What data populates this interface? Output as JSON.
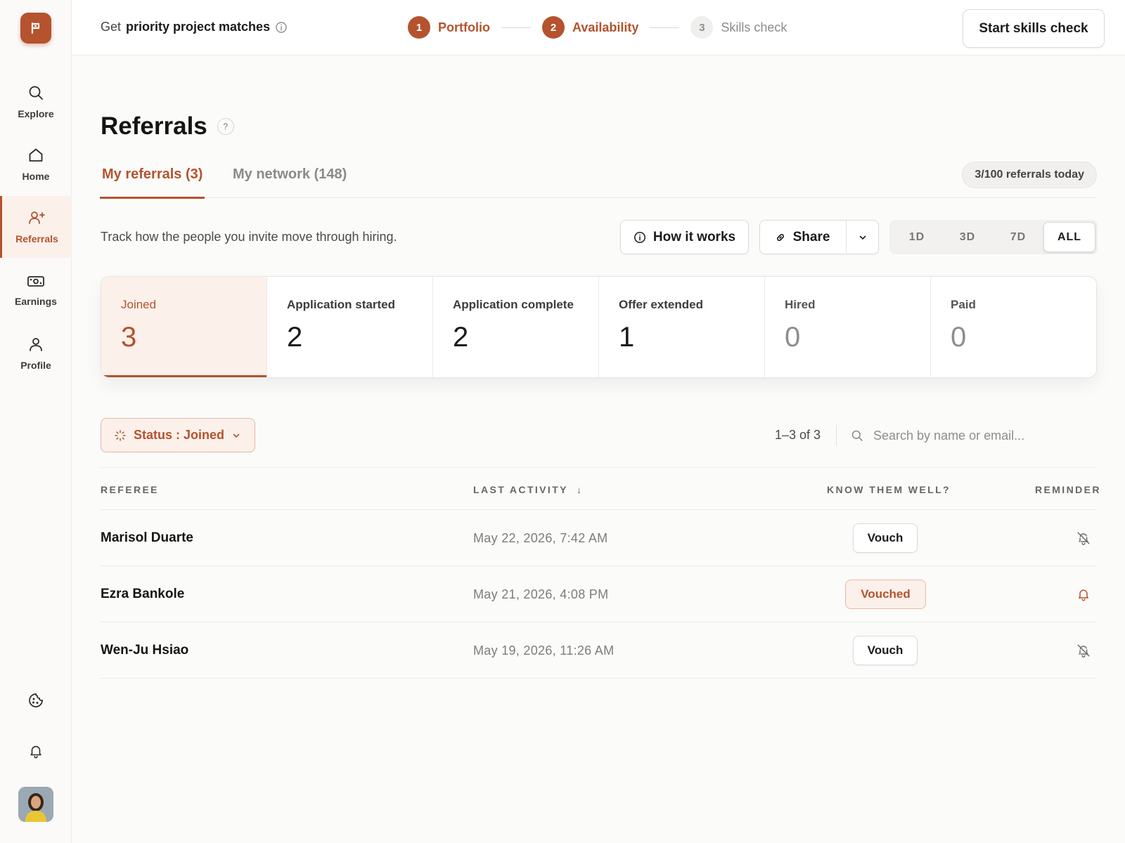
{
  "colors": {
    "accent": "#b4532d",
    "accent_soft": "#fbf0ea",
    "text": "#1c1c1c",
    "muted": "#8d8d8d"
  },
  "sidebar": {
    "logo_icon": "flag-icon",
    "items": [
      {
        "label": "Explore",
        "icon": "search-icon"
      },
      {
        "label": "Home",
        "icon": "home-icon"
      },
      {
        "label": "Referrals",
        "icon": "add-user-icon",
        "active": true
      },
      {
        "label": "Earnings",
        "icon": "money-icon"
      },
      {
        "label": "Profile",
        "icon": "user-icon"
      }
    ],
    "bottom_icons": [
      "cookie-icon",
      "bell-icon"
    ]
  },
  "topbar": {
    "promo_prefix": "Get",
    "promo_strong": "priority project matches",
    "steps": [
      {
        "num": "1",
        "label": "Portfolio",
        "state": "done"
      },
      {
        "num": "2",
        "label": "Availability",
        "state": "done"
      },
      {
        "num": "3",
        "label": "Skills check",
        "state": "todo"
      }
    ],
    "cta": "Start skills check"
  },
  "page": {
    "title": "Referrals",
    "help": "?",
    "tabs": [
      {
        "label": "My referrals (3)",
        "active": true
      },
      {
        "label": "My network (148)",
        "active": false
      }
    ],
    "daily_count": "3/100 referrals today",
    "subtitle": "Track how the people you invite move through hiring.",
    "how_it_works": "How it works",
    "share": "Share",
    "ranges": [
      "1D",
      "3D",
      "7D",
      "ALL"
    ],
    "selected_range": "ALL"
  },
  "funnel": [
    {
      "label": "Joined",
      "value": "3",
      "active": true
    },
    {
      "label": "Application started",
      "value": "2"
    },
    {
      "label": "Application complete",
      "value": "2"
    },
    {
      "label": "Offer extended",
      "value": "1"
    },
    {
      "label": "Hired",
      "value": "0",
      "muted": true
    },
    {
      "label": "Paid",
      "value": "0",
      "muted": true
    }
  ],
  "filter": {
    "label": "Status : Joined"
  },
  "pager": "1–3 of 3",
  "search": {
    "placeholder": "Search by name or email..."
  },
  "table": {
    "headers": {
      "referee": "REFEREE",
      "last_activity": "LAST ACTIVITY",
      "sort_arrow": "↓",
      "know": "KNOW THEM WELL?",
      "reminder": "REMINDER"
    },
    "rows": [
      {
        "name": "Marisol Duarte",
        "date": "May 22, 2026, 7:42 AM",
        "vouch": "Vouch",
        "vouched": false,
        "reminder_icon": "bell-off-icon"
      },
      {
        "name": "Ezra Bankole",
        "date": "May 21, 2026, 4:08 PM",
        "vouch": "Vouched",
        "vouched": true,
        "reminder_icon": "bell-icon"
      },
      {
        "name": "Wen-Ju Hsiao",
        "date": "May 19, 2026, 11:26 AM",
        "vouch": "Vouch",
        "vouched": false,
        "reminder_icon": "bell-off-icon"
      }
    ]
  }
}
